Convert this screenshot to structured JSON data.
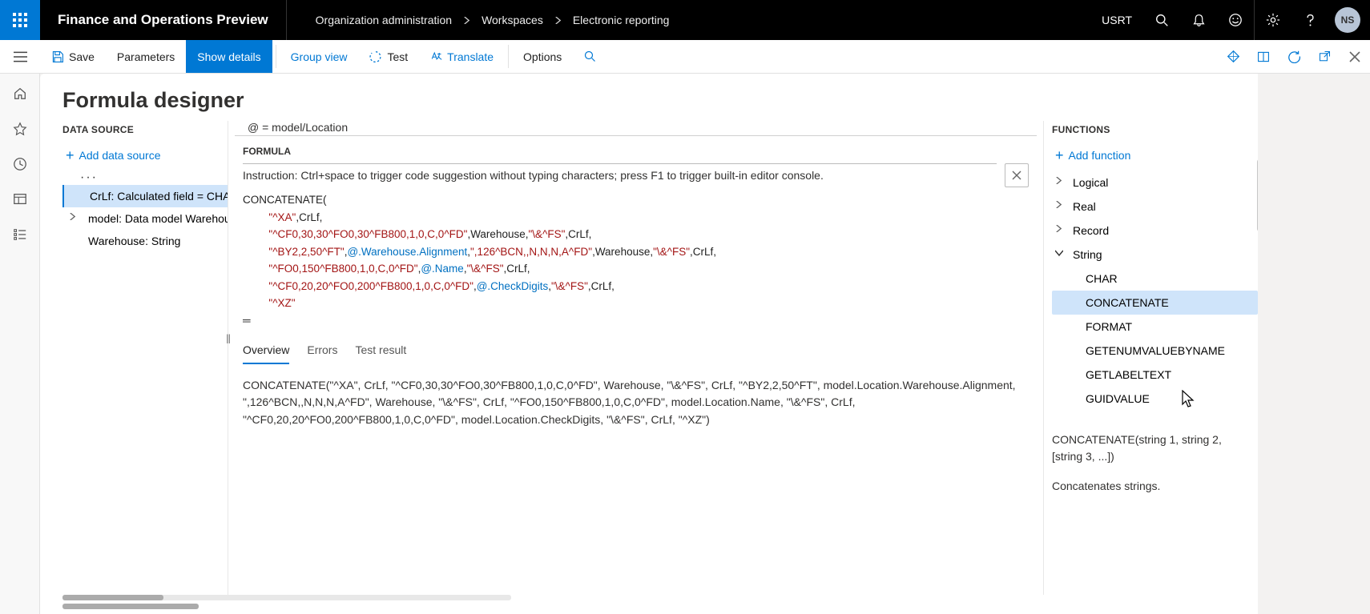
{
  "topbar": {
    "title": "Finance and Operations Preview",
    "breadcrumbs": [
      "Organization administration",
      "Workspaces",
      "Electronic reporting"
    ],
    "company": "USRT",
    "avatar": "NS"
  },
  "actionbar": {
    "save": "Save",
    "parameters": "Parameters",
    "show_details": "Show details",
    "group_view": "Group view",
    "test": "Test",
    "translate": "Translate",
    "options": "Options"
  },
  "page": {
    "title": "Formula designer"
  },
  "data_source": {
    "header": "DATA SOURCE",
    "add": "Add data source",
    "items": [
      {
        "label": "CrLf: Calculated field = CHAR",
        "selected": true,
        "expandable": false
      },
      {
        "label": "model: Data model Warehouse",
        "selected": false,
        "expandable": true
      },
      {
        "label": "Warehouse: String",
        "selected": false,
        "expandable": false
      }
    ]
  },
  "formula": {
    "at_line": "@ = model/Location",
    "label": "FORMULA",
    "instruction": "Instruction: Ctrl+space to trigger code suggestion without typing characters; press F1 to trigger built-in editor console.",
    "code": {
      "l1": "CONCATENATE(",
      "l2a": "\"^XA\"",
      "l2b": ",CrLf,",
      "l3a": "\"^CF0,30,30^FO0,30^FB800,1,0,C,0^FD\"",
      "l3b": ",Warehouse,",
      "l3c": "\"\\&^FS\"",
      "l3d": ",CrLf,",
      "l4a": "\"^BY2,2,50^FT\"",
      "l4b": ",",
      "l4c": "@.Warehouse.Alignment",
      "l4d": ",",
      "l4e": "\",126^BCN,,N,N,N,A^FD\"",
      "l4f": ",Warehouse,",
      "l4g": "\"\\&^FS\"",
      "l4h": ",CrLf,",
      "l5a": "\"^FO0,150^FB800,1,0,C,0^FD\"",
      "l5b": ",",
      "l5c": "@.Name",
      "l5d": ",",
      "l5e": "\"\\&^FS\"",
      "l5f": ",CrLf,",
      "l6a": "\"^CF0,20,20^FO0,200^FB800,1,0,C,0^FD\"",
      "l6b": ",",
      "l6c": "@.CheckDigits",
      "l6d": ",",
      "l6e": "\"\\&^FS\"",
      "l6f": ",CrLf,",
      "l7": "\"^XZ\"",
      "l8": ")"
    }
  },
  "tabs": {
    "overview": "Overview",
    "errors": "Errors",
    "test_result": "Test result"
  },
  "overview_text": "CONCATENATE(\"^XA\", CrLf, \"^CF0,30,30^FO0,30^FB800,1,0,C,0^FD\", Warehouse, \"\\&^FS\", CrLf, \"^BY2,2,50^FT\", model.Location.Warehouse.Alignment, \",126^BCN,,N,N,N,A^FD\", Warehouse, \"\\&^FS\", CrLf, \"^FO0,150^FB800,1,0,C,0^FD\", model.Location.Name, \"\\&^FS\", CrLf, \"^CF0,20,20^FO0,200^FB800,1,0,C,0^FD\", model.Location.CheckDigits, \"\\&^FS\", CrLf, \"^XZ\")",
  "functions": {
    "header": "FUNCTIONS",
    "add": "Add function",
    "categories": [
      {
        "name": "Logical",
        "expanded": false
      },
      {
        "name": "Real",
        "expanded": false
      },
      {
        "name": "Record",
        "expanded": false
      },
      {
        "name": "String",
        "expanded": true
      }
    ],
    "string_items": [
      "CHAR",
      "CONCATENATE",
      "FORMAT",
      "GETENUMVALUEBYNAME",
      "GETLABELTEXT",
      "GUIDVALUE"
    ],
    "selected": "CONCATENATE",
    "help_sig": "CONCATENATE(string 1, string 2, [string 3, ...])",
    "help_desc": "Concatenates strings."
  }
}
